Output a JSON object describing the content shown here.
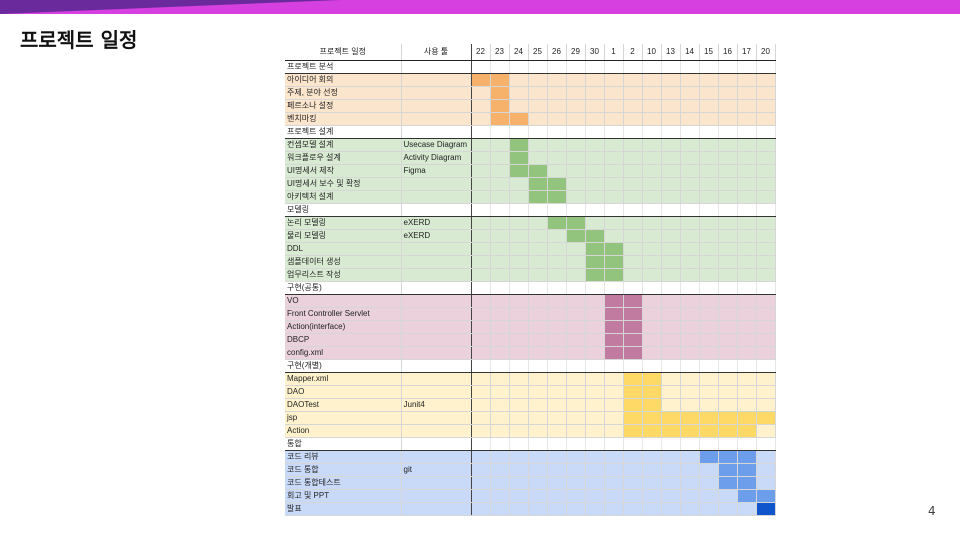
{
  "title": "프로젝트 일정",
  "page_number": "4",
  "header": {
    "task": "프로젝트 일정",
    "tool": "사용 툴"
  },
  "days": [
    "22",
    "23",
    "24",
    "25",
    "26",
    "29",
    "30",
    "1",
    "2",
    "10",
    "13",
    "14",
    "15",
    "16",
    "17",
    "20"
  ],
  "colors": {
    "analysis": {
      "bg": "#fce5cd",
      "bar": "#f6b26b"
    },
    "design": {
      "bg": "#d9ead3",
      "bar": "#93c47d"
    },
    "impl_common": {
      "bg": "#ead1dc",
      "bar": "#c27ba0"
    },
    "impl_individual": {
      "bg": "#fff2cc",
      "bar": "#ffd966"
    },
    "integration": {
      "bg": "#c9daf8",
      "bar": "#6d9eeb",
      "final": "#1155cc"
    }
  },
  "sections": [
    {
      "name": "프로젝트 분석",
      "theme": "analysis",
      "tasks": [
        {
          "label": "아이디어 회의",
          "tool": "",
          "active": [
            0,
            1
          ]
        },
        {
          "label": "주제, 분야 선정",
          "tool": "",
          "active": [
            1
          ]
        },
        {
          "label": "페르소나 설정",
          "tool": "",
          "active": [
            1
          ]
        },
        {
          "label": "벤치마킹",
          "tool": "",
          "active": [
            1,
            2
          ]
        }
      ]
    },
    {
      "name": "프로젝트 설계",
      "theme": "design",
      "tasks": [
        {
          "label": "컨셉모델 설계",
          "tool": "Usecase Diagram",
          "active": [
            2
          ]
        },
        {
          "label": "워크플로우 설계",
          "tool": "Activity Diagram",
          "active": [
            2
          ]
        },
        {
          "label": "UI명세서 제작",
          "tool": "Figma",
          "active": [
            2,
            3
          ]
        },
        {
          "label": "UI명세서 보수 및 확정",
          "tool": "",
          "active": [
            3,
            4
          ]
        },
        {
          "label": "아키텍처 설계",
          "tool": "",
          "active": [
            3,
            4
          ]
        }
      ]
    },
    {
      "name": "모델링",
      "theme": "design",
      "tasks": [
        {
          "label": "논리 모델링",
          "tool": "eXERD",
          "active": [
            4,
            5
          ]
        },
        {
          "label": "물리 모델링",
          "tool": "eXERD",
          "active": [
            5,
            6
          ]
        },
        {
          "label": "DDL",
          "tool": "",
          "active": [
            6,
            7
          ]
        },
        {
          "label": "샘플데이터 생성",
          "tool": "",
          "active": [
            6,
            7
          ]
        },
        {
          "label": "업무리스트 작성",
          "tool": "",
          "active": [
            6,
            7
          ]
        }
      ]
    },
    {
      "name": "구현(공통)",
      "theme": "impl_common",
      "tasks": [
        {
          "label": "VO",
          "tool": "",
          "active": [
            7,
            8
          ]
        },
        {
          "label": "Front Controller Servlet",
          "tool": "",
          "active": [
            7,
            8
          ]
        },
        {
          "label": "Action(interface)",
          "tool": "",
          "active": [
            7,
            8
          ]
        },
        {
          "label": "DBCP",
          "tool": "",
          "active": [
            7,
            8
          ]
        },
        {
          "label": "config.xml",
          "tool": "",
          "active": [
            7,
            8
          ]
        }
      ]
    },
    {
      "name": "구현(개별)",
      "theme": "impl_individual",
      "tasks": [
        {
          "label": "Mapper.xml",
          "tool": "",
          "active": [
            8,
            9
          ]
        },
        {
          "label": "DAO",
          "tool": "",
          "active": [
            8,
            9
          ]
        },
        {
          "label": "DAOTest",
          "tool": "Junit4",
          "active": [
            8,
            9
          ]
        },
        {
          "label": "jsp",
          "tool": "",
          "active": [
            8,
            9,
            10,
            11,
            12,
            13,
            14,
            15
          ]
        },
        {
          "label": "Action",
          "tool": "",
          "active": [
            8,
            9,
            10,
            11,
            12,
            13,
            14
          ]
        }
      ]
    },
    {
      "name": "통합",
      "theme": "integration",
      "tasks": [
        {
          "label": "코드 리뷰",
          "tool": "",
          "active": [
            12,
            13,
            14
          ]
        },
        {
          "label": "코드 통합",
          "tool": "git",
          "active": [
            13,
            14
          ]
        },
        {
          "label": "코드 통합테스트",
          "tool": "",
          "active": [
            13,
            14
          ]
        },
        {
          "label": "회고 및 PPT",
          "tool": "",
          "active": [
            14,
            15
          ]
        },
        {
          "label": "발표",
          "tool": "",
          "active": [
            15
          ],
          "final": true
        }
      ]
    }
  ]
}
